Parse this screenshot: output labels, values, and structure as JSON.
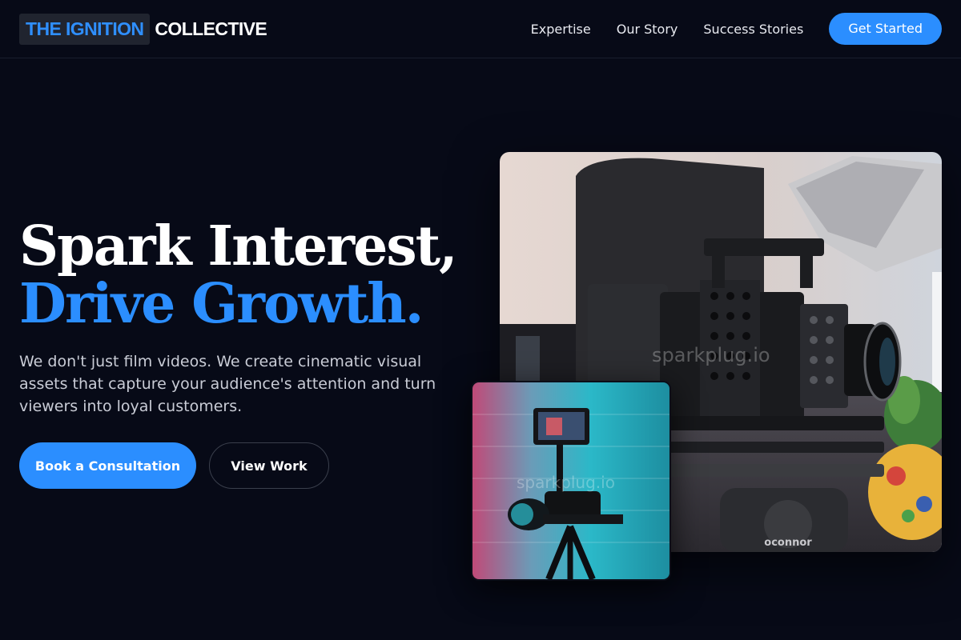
{
  "header": {
    "logo_highlight": "THE IGNITION",
    "logo_rest": "COLLECTIVE",
    "nav": [
      "Expertise",
      "Our Story",
      "Success Stories"
    ],
    "cta_label": "Get Started"
  },
  "hero": {
    "title_line1": "Spark Interest,",
    "title_line2": "Drive Growth.",
    "description": "We don't just film videos. We create cinematic visual assets that capture your audience's attention and turn viewers into loyal customers.",
    "primary_button": "Book a Consultation",
    "secondary_button": "View Work"
  },
  "images": {
    "main_watermark": "sparkplug.io",
    "main_brand": "oconnor",
    "small_watermark": "sparkplug.io"
  },
  "colors": {
    "background": "#070a17",
    "accent": "#2b8eff",
    "logo_box": "#20242f"
  }
}
